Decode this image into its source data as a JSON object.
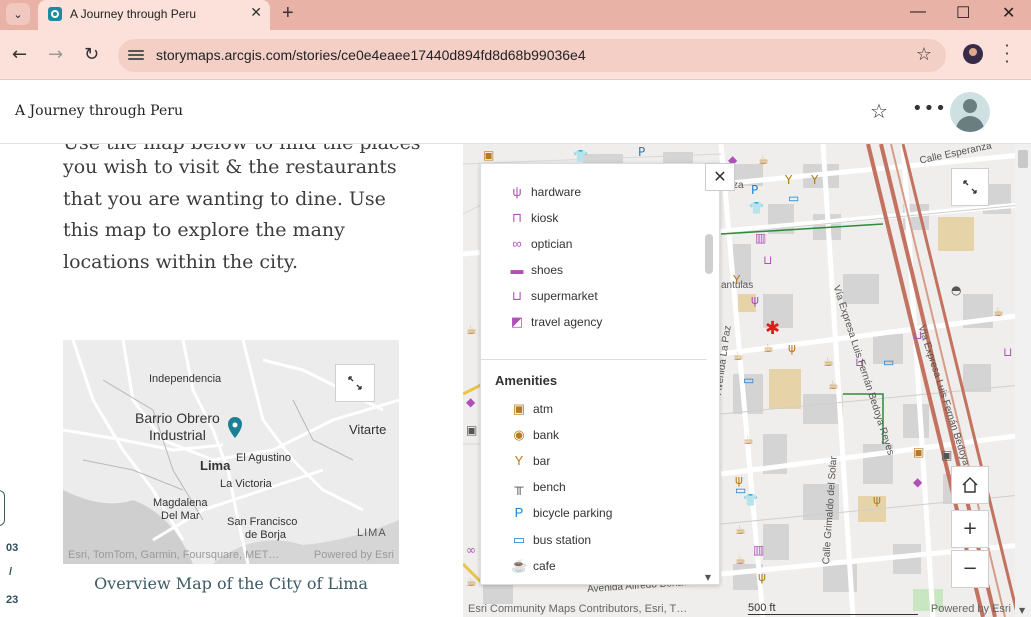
{
  "browser": {
    "tab_title": "A Journey through Peru",
    "new_tab": "+",
    "url": "storymaps.arcgis.com/stories/ce0e4eaee17440d894fd8d68b99036e4",
    "minimize": "—",
    "maximize": "☐",
    "close": "✕"
  },
  "story": {
    "title": "A Journey through Peru"
  },
  "narrative": {
    "cut_line": "Use the map below to find the places",
    "paragraph": "you wish to visit & the restaurants that you are wanting to dine. Use this map to explore the many locations within the city.",
    "caption": "Overview Map of the City of Lima"
  },
  "overview_map": {
    "labels": {
      "independencia": "Independencia",
      "barrio": "Barrio Obrero",
      "industrial": "Industrial",
      "vitarte": "Vitarte",
      "lima": "Lima",
      "el_agustino": "El Agustino",
      "la_victoria": "La Victoria",
      "magdalena": "Magdalena",
      "del_mar": "Del Mar",
      "san_francisco": "San Francisco",
      "de_borja": "de Borja",
      "lima_caps": "LIMA"
    },
    "attribution": "Esri, TomTom, Garmin, Foursquare, MET…",
    "powered": "Powered by Esri"
  },
  "pager": {
    "current": "03",
    "sep": "/",
    "total": "23"
  },
  "legend": {
    "shops": [
      {
        "icon": "ψ",
        "label": "hardware",
        "color": "#b04fb8"
      },
      {
        "icon": "⊓",
        "label": "kiosk",
        "color": "#b04fb8"
      },
      {
        "icon": "∞",
        "label": "optician",
        "color": "#b04fb8"
      },
      {
        "icon": "▬",
        "label": "shoes",
        "color": "#b04fb8"
      },
      {
        "icon": "⊔",
        "label": "supermarket",
        "color": "#b04fb8"
      },
      {
        "icon": "◩",
        "label": "travel agency",
        "color": "#b04fb8"
      }
    ],
    "amenities_title": "Amenities",
    "amenities": [
      {
        "icon": "▣",
        "label": "atm",
        "color": "#b87a1c"
      },
      {
        "icon": "◉",
        "label": "bank",
        "color": "#b87a1c"
      },
      {
        "icon": "Y",
        "label": "bar",
        "color": "#b87a1c"
      },
      {
        "icon": "╥",
        "label": "bench",
        "color": "#555555"
      },
      {
        "icon": "P",
        "label": "bicycle parking",
        "color": "#1b7fd1"
      },
      {
        "icon": "▭",
        "label": "bus station",
        "color": "#1b7fd1"
      },
      {
        "icon": "☕",
        "label": "cafe",
        "color": "#b87a1c"
      }
    ]
  },
  "map": {
    "streets": {
      "calle_esperanza": "Calle Esperanza",
      "avenida_la_paz": "Avenida La Paz",
      "via_expresa_1": "Vía Expresa Luis Fernán Bedoya Reyes",
      "via_expresa_2": "Vía Expresa Luis Fernán Bedoya",
      "calle_grimaldo": "Calle Grimaldo del Solar",
      "avenida_alfredo": "Avenida Alfredo Benavides",
      "diez": "…za",
      "antulas": "antulas"
    },
    "attribution": "Esri Community Maps Contributors, Esri, T…",
    "scale": "500 ft",
    "powered": "Powered by Esri",
    "close_legend": "✕",
    "zoom_in": "+",
    "zoom_out": "−"
  }
}
